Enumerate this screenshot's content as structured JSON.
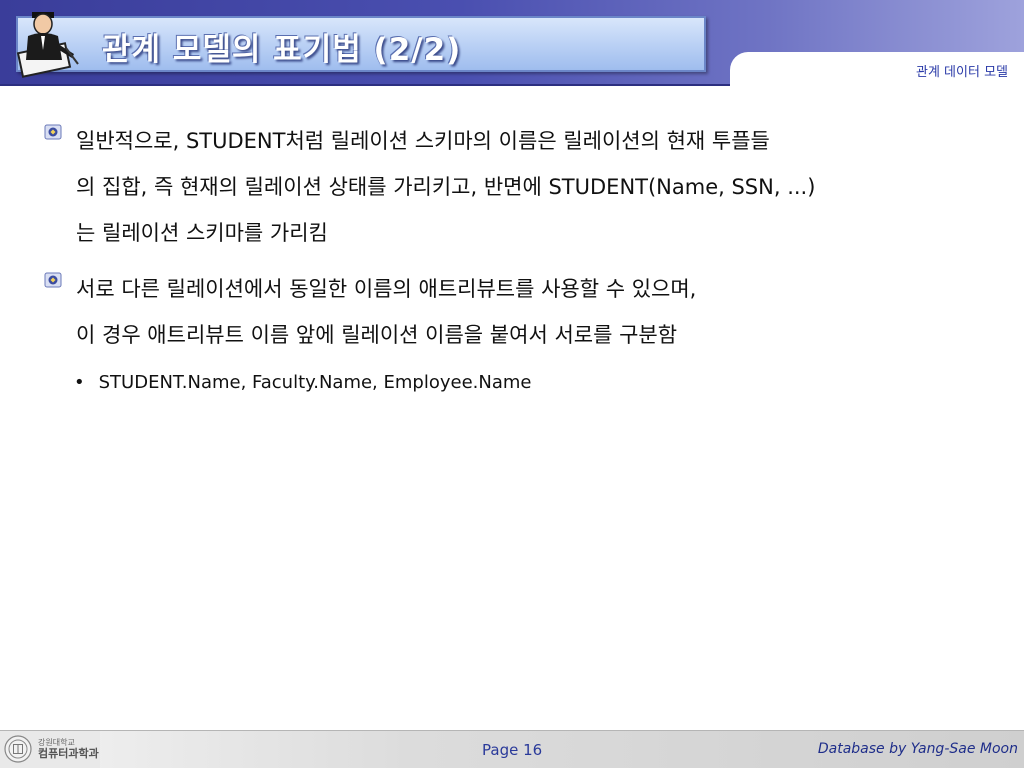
{
  "header": {
    "title": "관계 모델의 표기법 (2/2)",
    "category": "관계 데이터 모델"
  },
  "bullets": [
    {
      "icon": "school-emblem-icon",
      "lines": [
        "일반적으로, STUDENT처럼 릴레이션 스키마의 이름은 릴레이션의 현재 투플들",
        "의 집합, 즉 현재의 릴레이션 상태를 가리키고, 반면에 STUDENT(Name, SSN, ...)",
        "는 릴레이션 스키마를 가리킴"
      ]
    },
    {
      "icon": "school-emblem-icon",
      "lines": [
        "서로 다른 릴레이션에서 동일한 이름의 애트리뷰트를 사용할 수 있으며,",
        "이 경우 애트리뷰트 이름 앞에 릴레이션 이름을 붙여서 서로를 구분함"
      ]
    }
  ],
  "sub_bullet": {
    "marker": "•",
    "text": "STUDENT.Name, Faculty.Name, Employee.Name"
  },
  "footer": {
    "school": "강원대학교",
    "department": "컴퓨터과학과",
    "page": "Page 16",
    "credit": "Database by Yang-Sae Moon"
  },
  "colors": {
    "header_gradient_start": "#3a3d9a",
    "header_gradient_end": "#9ea2dc",
    "title_box": "#b8cff4",
    "accent_text": "#2a3aa8"
  }
}
